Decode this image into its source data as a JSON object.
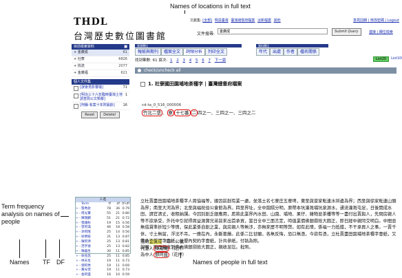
{
  "annotations": {
    "top": "Names of locations in full text",
    "left": "Term frequency analysis on names of people",
    "bottom_names": "Names",
    "bottom_tf": "TF",
    "bottom_df": "DF",
    "bottom_right": "Names of people in full text"
  },
  "header": {
    "brand_en": "THDL",
    "brand_zh": "台灣歷史數位圖書館",
    "db_prefix": "文獻集:",
    "db_links": [
      "[全部]",
      "明清臺灣",
      "臺灣總督府檔案",
      "淡新檔案",
      "其他"
    ],
    "account_links": "意見回饋 | 修改密碼 | Logout",
    "search_label": "文件搜尋:",
    "search_value": "金廣成",
    "submit": "Submit Query",
    "search_links": "連接 | 欄位檢索"
  },
  "sidebar": {
    "header": "目前檢索資料",
    "rows": [
      {
        "label": "+ 金廣成",
        "count": "61"
      },
      {
        "label": "+ 社寮",
        "count": "6826"
      },
      {
        "label": "+ 找流",
        "count": "2077"
      },
      {
        "label": "+ 金廣福",
        "count": "621"
      }
    ],
    "lib_header": "個人文件集",
    "libs": [
      {
        "label": "[誤會見影響檔]",
        "count": "71"
      },
      {
        "label": "[明治三十六年臨時臺灣土地調查局公文類纂]",
        "count": "1"
      },
      {
        "label": "[阿縣-有案十年附最齡]",
        "count": "16"
      }
    ],
    "reset": "Reset",
    "delete": "Delete!"
  },
  "tf_panel": {
    "title": "人名",
    "columns": [
      "Term",
      "tf",
      "df",
      "tf-idf"
    ],
    "rows": [
      {
        "name": "張秀欽",
        "tf": "78",
        "df": "36",
        "tfidf": "0.79"
      },
      {
        "name": "周光寶",
        "tf": "55",
        "df": "21",
        "tfidf": "0.80"
      },
      {
        "name": "陳瑞麟",
        "tf": "51",
        "df": "21",
        "tfidf": "0.72"
      },
      {
        "name": "張鐵秋",
        "tf": "19",
        "df": "15",
        "tfidf": "0.56"
      },
      {
        "name": "曾阿滿",
        "tf": "46",
        "df": "18",
        "tfidf": "0.58"
      },
      {
        "name": "涂阿隆",
        "tf": "25",
        "df": "14",
        "tfidf": "0.56"
      },
      {
        "name": "徐明枝",
        "tf": "31",
        "df": "13",
        "tfidf": "0.87"
      },
      {
        "name": "陳阿添",
        "tf": "25",
        "df": "13",
        "tfidf": "0.81"
      },
      {
        "name": "范宇琥",
        "tf": "25",
        "df": "13",
        "tfidf": "0.82"
      },
      {
        "name": "陳蘊生",
        "tf": "30",
        "df": "11",
        "tfidf": "0.85"
      },
      {
        "name": "徐兆昌",
        "tf": "25",
        "df": "11",
        "tfidf": "0.85"
      },
      {
        "name": "林天生",
        "tf": "19",
        "df": "11",
        "tfidf": "0.73"
      },
      {
        "name": "鄧阿秀",
        "tf": "19",
        "df": "11",
        "tfidf": "0.69"
      },
      {
        "name": "黃光佳",
        "tf": "19",
        "df": "11",
        "tfidf": "0.73"
      },
      {
        "name": "金阿盛",
        "tf": "16",
        "df": "10",
        "tfidf": "0.59"
      }
    ]
  },
  "tabs": {
    "left_strip": "資源欄位",
    "left": [
      "報紙與期刊",
      "檔案全文",
      "詞頻分析",
      "列印全文"
    ],
    "right_strip": "資料欄位",
    "right": [
      "年代",
      "出處",
      "作者",
      "檔名關係"
    ]
  },
  "paging": {
    "prefix": "找到筆數: 61  頁次:",
    "pages": [
      "1",
      "2",
      "3",
      "4",
      "5",
      "6",
      "7"
    ],
    "next": "下一頁",
    "list20": "List20",
    "list100": "List100"
  },
  "check_bar": "check/uncheck all",
  "doc": {
    "title": "1. 社寮國田園埔地茶種字 | 臺灣總督府檔案",
    "id": "cd-ta_0_516_000006",
    "places": [
      "竹北二堡",
      "寮",
      "十七番",
      "二"
    ],
    "place_tail": "四之一、三四之一、三四之二",
    "fulltext": "立杜賣盡田園埔地茶種字人周協福等，緣因前創有業一處，坐落土名七寮庄五寮埤，東至與曾家毗連水圳邊為界；西至與徐家毗連山頭為界；南至大河為界；北至與福祝伯公會館為界。四至界址，全中園隔分明，原帶本坑灌溉埔坑泉源水，通流灌溉屯足，日後開成水田，請官清丈，收租納課。今因別創乏銀應用，愿將此業界內水田、山園、埔地、果仔、雜物並茶欉等等一盡付出賣與人，先問房親人等不欲承受，外托中引就得周益源寶兄弟前來出首承買，當日全中三面言定，時值業價佛銀捌拾大圓正，即日經中親同交明白。中間並無借貸準折短少等情，保此業係自創之業，與房親人等無涉，亦無來歷不明等弊。如有此情，係福一力抵擋，不干承買人之事。一賣千休，寸土無留，浮沈不吊，一應在內，永斷葛藤。此係二比甘願，各無反悔，恐口無憑，今欲有憑，立杜賣盡田園埔地茶種字壹紙，又帶承買糧契字壹紙，並墾內契約字壹紙，計共參紙，付執為照。",
    "note": "說明：即日親收到字內佛銀捌拾大圓正，親收足訖。批照。",
    "names_lines": [
      {
        "prefix": "憑約",
        "name": "金廣成",
        "suffix": "（印）公號",
        "style": "yellow"
      },
      {
        "prefix": "代筆人",
        "name": "陳鳳儀",
        "suffix": "（花押）",
        "style": "red"
      },
      {
        "prefix": "為中人",
        "name": "鄧阿盛",
        "suffix": "（花押）",
        "style": "red"
      }
    ]
  }
}
